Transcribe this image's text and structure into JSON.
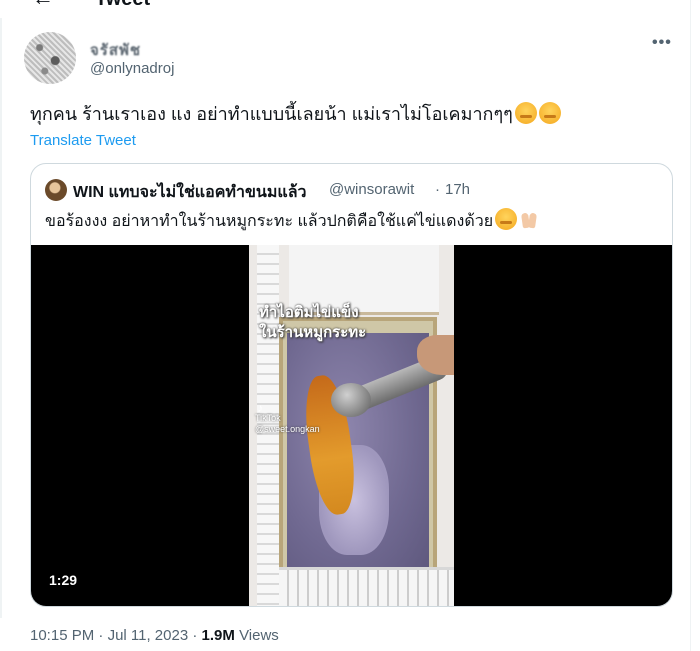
{
  "header": {
    "title": "Tweet",
    "back_icon": "arrow-left-icon"
  },
  "author": {
    "display_name": "จรัสพัช",
    "handle": "@onlynadroj"
  },
  "tweet": {
    "text": "ทุกคน ร้านเราเอง แง อย่าทำแบบนี้เลยน้า แม่เราไม่โอเคมากๆๆ",
    "translate_label": "Translate Tweet",
    "time": "10:15 PM",
    "date": "Jul 11, 2023",
    "separator": "·",
    "views_count": "1.9M",
    "views_label": "Views"
  },
  "quoted": {
    "name": "WIN แทบจะไม่ใช่แอคทำขนมแล้ว",
    "handle": "@winsorawit",
    "separator": "·",
    "time": "17h",
    "text": "ขอร้องงง อย่าหาทำในร้านหมูกระทะ แล้วปกติคือใช้แค่ไข่แดงด้วย",
    "video": {
      "duration": "1:29",
      "overlay_line1": "ทำไอติมไข่แข็ง",
      "overlay_line2": "ในร้านหมูกระทะ",
      "watermark_line1": "TikTok",
      "watermark_line2": "@sweet.ongkan"
    }
  },
  "colors": {
    "accent": "#1d9bf0",
    "secondary_text": "#536471",
    "border": "#cfd9de"
  },
  "icons": {
    "more": "more-horizontal-icon",
    "emoji": "smiling-face-emoji",
    "pray": "folded-hands-emoji"
  }
}
